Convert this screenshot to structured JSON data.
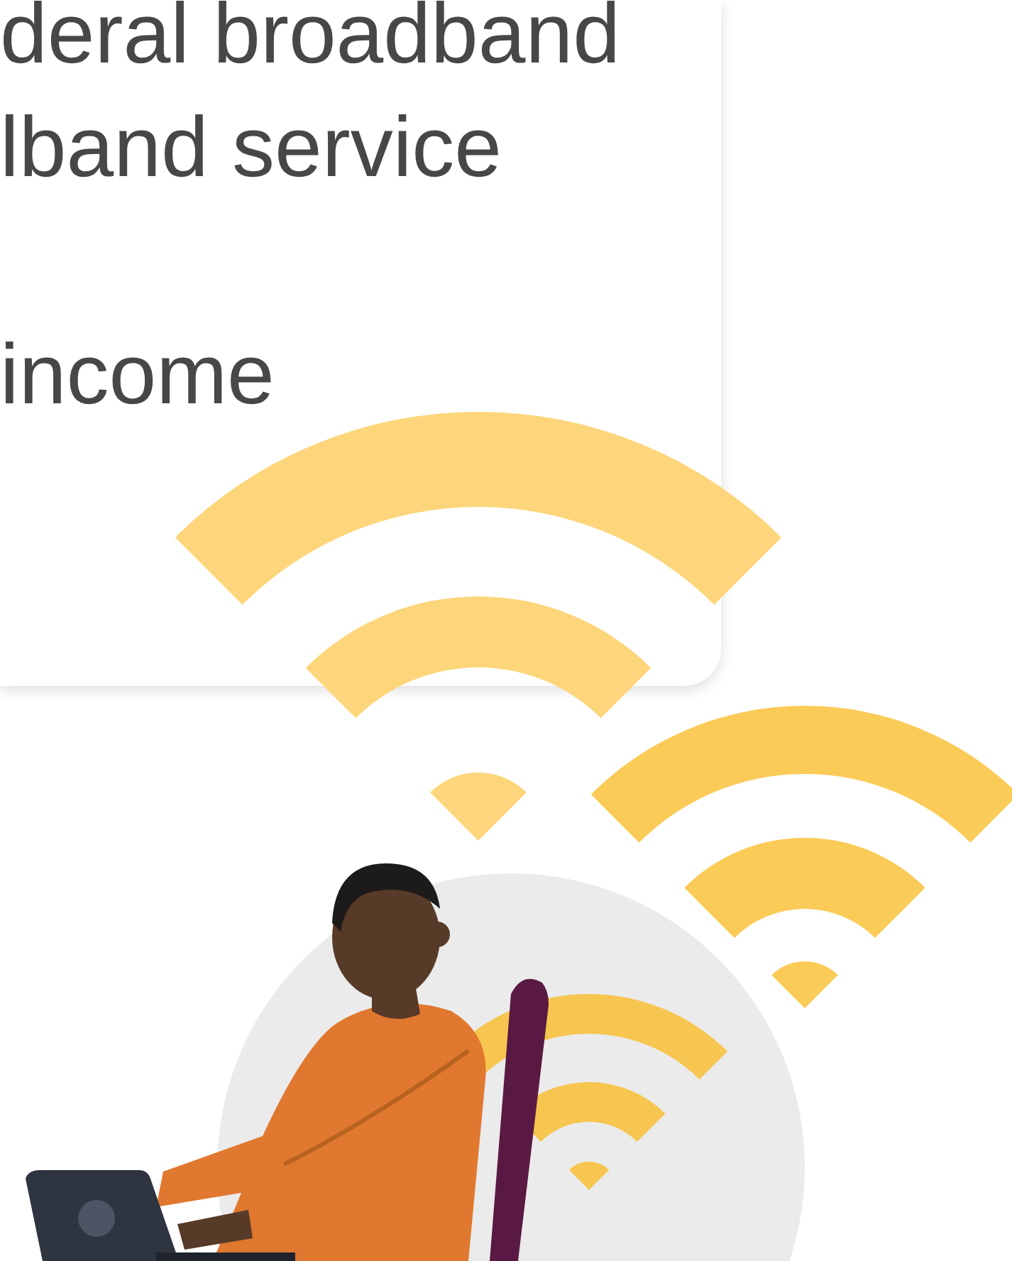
{
  "card": {
    "paragraphs": [
      {
        "lines": [
          "deral broadband",
          "lband service"
        ]
      },
      {
        "lines": [
          "income"
        ]
      }
    ]
  }
}
